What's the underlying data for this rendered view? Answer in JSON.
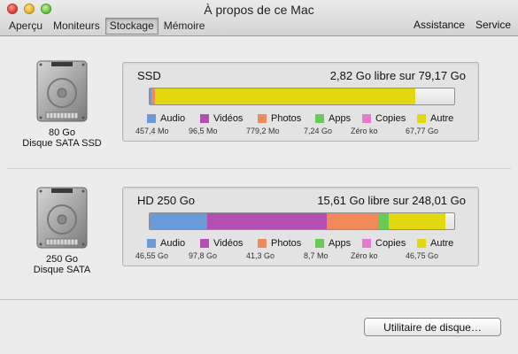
{
  "window": {
    "title": "À propos de ce Mac",
    "tabs": [
      "Aperçu",
      "Moniteurs",
      "Stockage",
      "Mémoire"
    ],
    "active_tab": "Stockage",
    "right_links": [
      "Assistance",
      "Service"
    ]
  },
  "disks": [
    {
      "size": "80 Go",
      "type": "Disque SATA SSD",
      "volume": "SSD",
      "free_text": "2,82 Go libre sur 79,17 Go",
      "usage_fractions": [
        0.006,
        0.001,
        0.01,
        0.0001,
        0.0,
        0.855
      ],
      "legend": [
        {
          "label": "Audio",
          "value": "457,4 Mo",
          "color": "#6a9bd8"
        },
        {
          "label": "Vidéos",
          "value": "96,5 Mo",
          "color": "#b24fb0"
        },
        {
          "label": "Photos",
          "value": "779,2 Mo",
          "color": "#f08a5b"
        },
        {
          "label": "Apps",
          "value": "7,24 Go",
          "color": "#66cc55"
        },
        {
          "label": "Copies",
          "value": "Zéro ko",
          "color": "#e57ad0"
        },
        {
          "label": "Autre",
          "value": "67,77 Go",
          "color": "#e2d80f"
        }
      ]
    },
    {
      "size": "250 Go",
      "type": "Disque SATA",
      "volume": "HD 250 Go",
      "free_text": "15,61 Go libre sur 248,01 Go",
      "usage_fractions": [
        0.188,
        0.394,
        0.167,
        0.035,
        0.0,
        0.188
      ],
      "legend": [
        {
          "label": "Audio",
          "value": "46,55 Go",
          "color": "#6a9bd8"
        },
        {
          "label": "Vidéos",
          "value": "97,8 Go",
          "color": "#b24fb0"
        },
        {
          "label": "Photos",
          "value": "41,3 Go",
          "color": "#f08a5b"
        },
        {
          "label": "Apps",
          "value": "8,7 Mo",
          "color": "#66cc55"
        },
        {
          "label": "Copies",
          "value": "Zéro ko",
          "color": "#e57ad0"
        },
        {
          "label": "Autre",
          "value": "46,75 Go",
          "color": "#e2d80f"
        }
      ]
    }
  ],
  "button_label": "Utilitaire de disque…"
}
